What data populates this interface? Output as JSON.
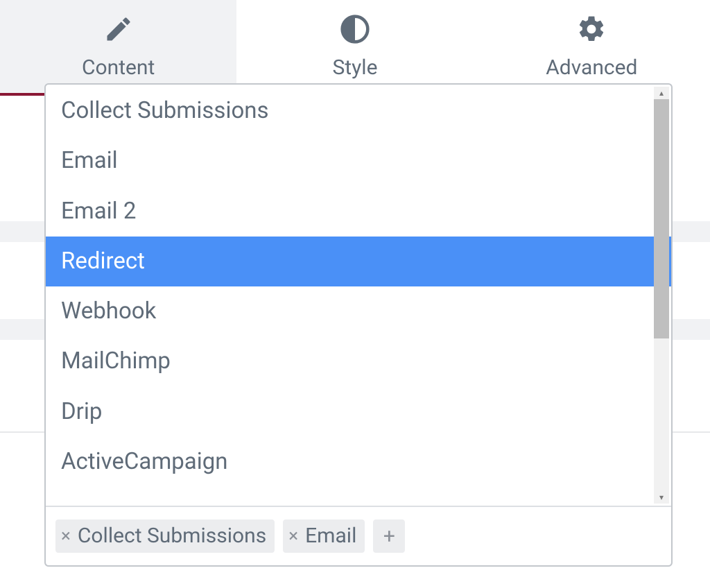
{
  "tabs": [
    {
      "label": "Content",
      "icon": "pencil-icon",
      "active": true
    },
    {
      "label": "Style",
      "icon": "contrast-icon",
      "active": false
    },
    {
      "label": "Advanced",
      "icon": "gear-icon",
      "active": false
    }
  ],
  "options": [
    {
      "label": "Collect Submissions",
      "highlighted": false
    },
    {
      "label": "Email",
      "highlighted": false
    },
    {
      "label": "Email 2",
      "highlighted": false
    },
    {
      "label": "Redirect",
      "highlighted": true
    },
    {
      "label": "Webhook",
      "highlighted": false
    },
    {
      "label": "MailChimp",
      "highlighted": false
    },
    {
      "label": "Drip",
      "highlighted": false
    },
    {
      "label": "ActiveCampaign",
      "highlighted": false
    }
  ],
  "chips": [
    {
      "label": "Collect Submissions"
    },
    {
      "label": "Email"
    }
  ],
  "add_icon_text": "+",
  "scroll_arrow_up": "▴",
  "scroll_arrow_down": "▾",
  "close_glyph": "×"
}
